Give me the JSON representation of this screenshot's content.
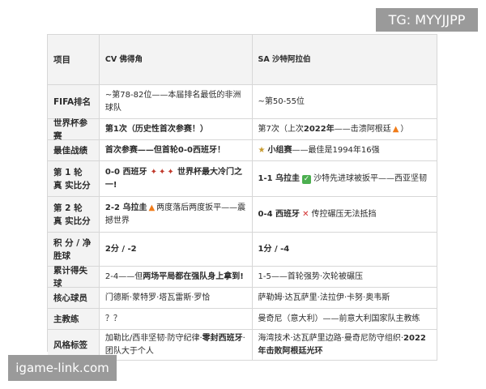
{
  "watermark_top": "TG: MYYJJPP",
  "watermark_bottom": "igame-link.com",
  "header": {
    "c0": "项目",
    "c1": "CV 佛得角",
    "c2": "SA 沙特阿拉伯"
  },
  "rows": [
    {
      "label": "FIFA排名",
      "c1": "~第78-82位——本届排名最低的非洲球队",
      "c2": "~第50-55位"
    },
    {
      "label": "世界杯参赛",
      "c1": "第1次（历史性首次参赛！）",
      "c2_pre": "第7次（上次",
      "c2_bold": "2022年",
      "c2_post": "——击溃阿根廷"
    },
    {
      "label": "最佳战绩",
      "c1": "首次参赛——但首轮0-0西班牙！",
      "c2_bold": "小组赛",
      "c2_post": "——最佳是1994年16强"
    },
    {
      "label": "第 1 轮 真 实比分",
      "c1_bold": "0-0 西班牙",
      "c1_post": "世界杯最大冷门之一!",
      "c2_bold": "1-1 乌拉圭",
      "c2_post": "沙特先进球被扳平——西亚坚韧"
    },
    {
      "label": "第 2 轮 真 实比分",
      "c1_bold": "2-2 乌拉圭",
      "c1_post": "两度落后两度扳平——震撼世界",
      "c2_bold": "0-4 西班牙",
      "c2_post": "传控碾压无法抵挡"
    },
    {
      "label": "积 分 / 净 胜球",
      "c1": "2分 / -2",
      "c2": "1分 / -4"
    },
    {
      "label": "累计得失球",
      "c1_pre": "2-4——但",
      "c1_bold": "两场平局都在强队身上拿到!",
      "c2": "1-5——首轮强势·次轮被碾压"
    },
    {
      "label": "核心球员",
      "c1": "门德斯·蒙特罗·塔瓦雷斯·罗恰",
      "c2": "萨勒姆·达瓦萨里·法拉伊·卡努·奥韦斯"
    },
    {
      "label": "主教练",
      "c1": "？？",
      "c2": "曼奇尼（意大利）——前意大利国家队主教练"
    },
    {
      "label": "风格标签",
      "c1_pre": "加勒比/西非坚韧·防守纪律·",
      "c1_bold": "零封西班牙",
      "c1_post": "·团队大于个人",
      "c2_pre": "海湾技术·达瓦萨里边路·曼奇尼防守组织·",
      "c2_bold": "2022年击败阿根廷光环"
    }
  ]
}
